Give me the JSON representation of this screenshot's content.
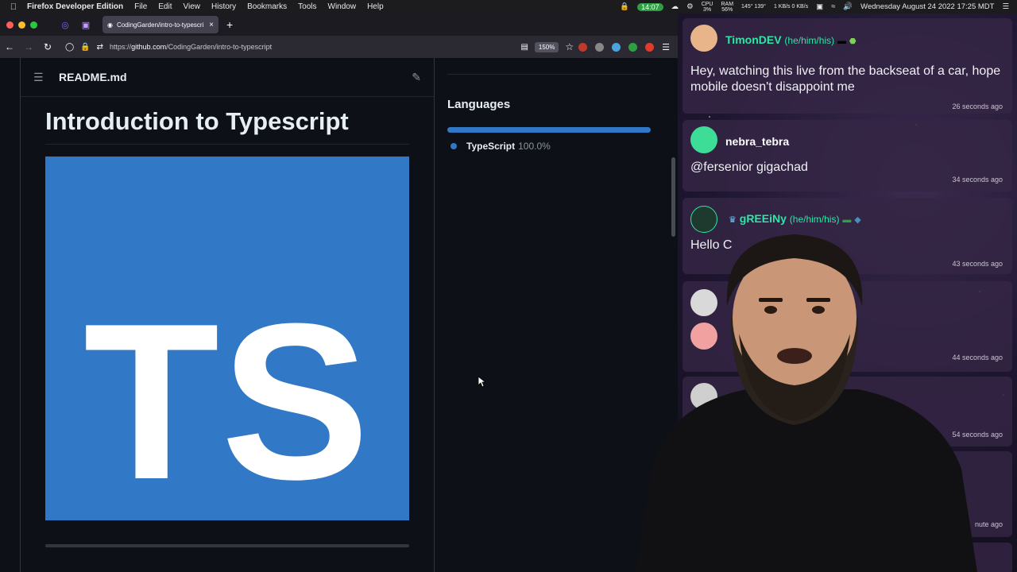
{
  "menubar": {
    "app_name": "Firefox Developer Edition",
    "menus": [
      "File",
      "Edit",
      "View",
      "History",
      "Bookmarks",
      "Tools",
      "Window",
      "Help"
    ],
    "clock_pill": "14:07",
    "cpu": "3%",
    "ram": "56%",
    "temps": "145° 139°",
    "net": "1 KB/s 0 KB/s",
    "datetime": "Wednesday August 24 2022 17:25 MDT"
  },
  "browser": {
    "tab_title": "CodingGarden/intro-to-typescri",
    "url_prefix": "https://",
    "url_host": "github.com",
    "url_path": "/CodingGarden/intro-to-typescript",
    "zoom": "150%"
  },
  "readme": {
    "filename": "README.md",
    "heading": "Introduction to Typescript",
    "logo_text": "TS",
    "logo_color": "#3178c6"
  },
  "sidebar": {
    "languages_title": "Languages",
    "languages": [
      {
        "name": "TypeScript",
        "percent": "100.0%",
        "share": 1.0,
        "color": "#3178c6"
      }
    ]
  },
  "chat": {
    "messages": [
      {
        "user": "TimonDEV",
        "pronouns": "(he/him/his)",
        "text": "Hey, watching this live from the backseat of a car, hope mobile doesn't disappoint me",
        "time": "26 seconds ago",
        "color": "#2ee6a6"
      },
      {
        "user": "nebra_tebra",
        "pronouns": "",
        "text": "@fersenior gigachad",
        "time": "34 seconds ago",
        "color": "#ffffff"
      },
      {
        "user": "gREEiNy",
        "pronouns": "(he/him/his)",
        "text": "Hello C",
        "time": "43 seconds ago",
        "color": "#2ee6a6"
      },
      {
        "user": "",
        "pronouns": "",
        "text": "",
        "time": "44 seconds ago",
        "color": "#ffffff"
      },
      {
        "user": "",
        "pronouns": "",
        "text": "",
        "time": "54 seconds ago",
        "color": "#ffffff"
      },
      {
        "user": "",
        "pronouns": "",
        "text": "",
        "time": "nute ago",
        "color": "#ffffff"
      }
    ]
  }
}
